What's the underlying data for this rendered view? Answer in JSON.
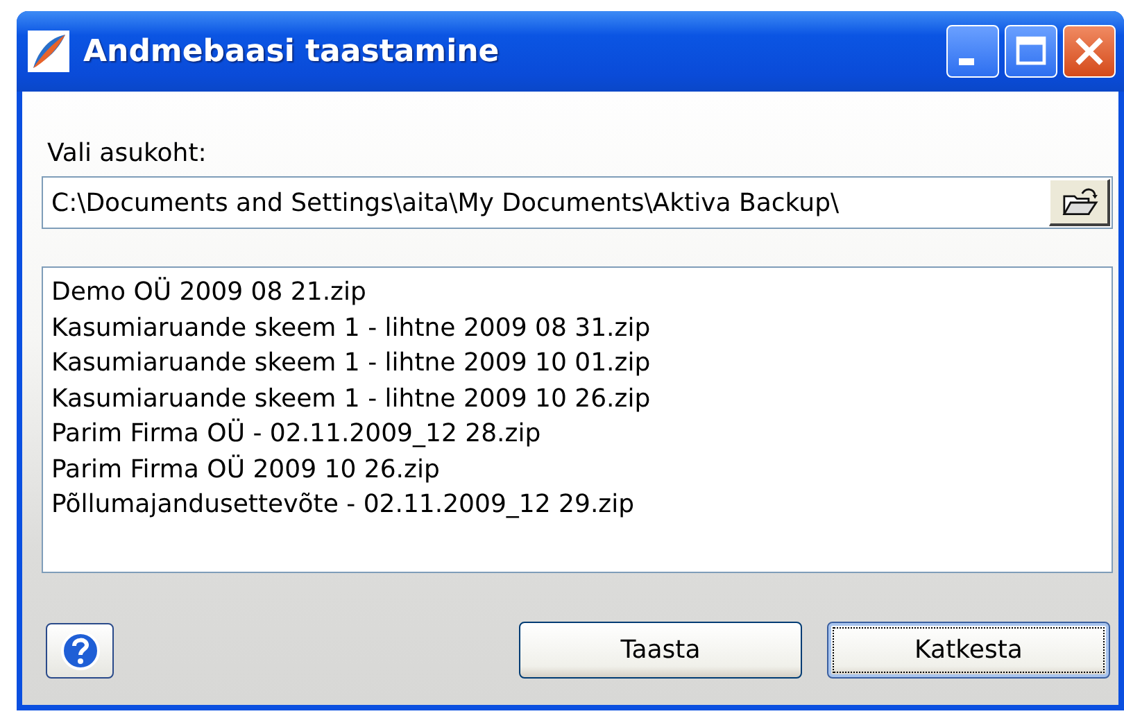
{
  "window": {
    "title": "Andmebaasi taastamine"
  },
  "location": {
    "label": "Vali asukoht:",
    "value": "C:\\Documents and Settings\\aita\\My Documents\\Aktiva Backup\\"
  },
  "files": [
    {
      "name": "Demo OÜ 2009 08 21.zip"
    },
    {
      "name": "Kasumiaruande skeem 1 - lihtne 2009 08 31.zip"
    },
    {
      "name": "Kasumiaruande skeem 1 - lihtne 2009 10 01.zip"
    },
    {
      "name": "Kasumiaruande skeem 1 - lihtne 2009 10 26.zip"
    },
    {
      "name": "Parim Firma OÜ - 02.11.2009_12 28.zip"
    },
    {
      "name": "Parim Firma OÜ 2009 10 26.zip"
    },
    {
      "name": "Põllumajandusettevõte - 02.11.2009_12 29.zip"
    }
  ],
  "buttons": [
    {
      "label": "Taasta",
      "focused": false
    },
    {
      "label": "Katkesta",
      "focused": true
    }
  ]
}
